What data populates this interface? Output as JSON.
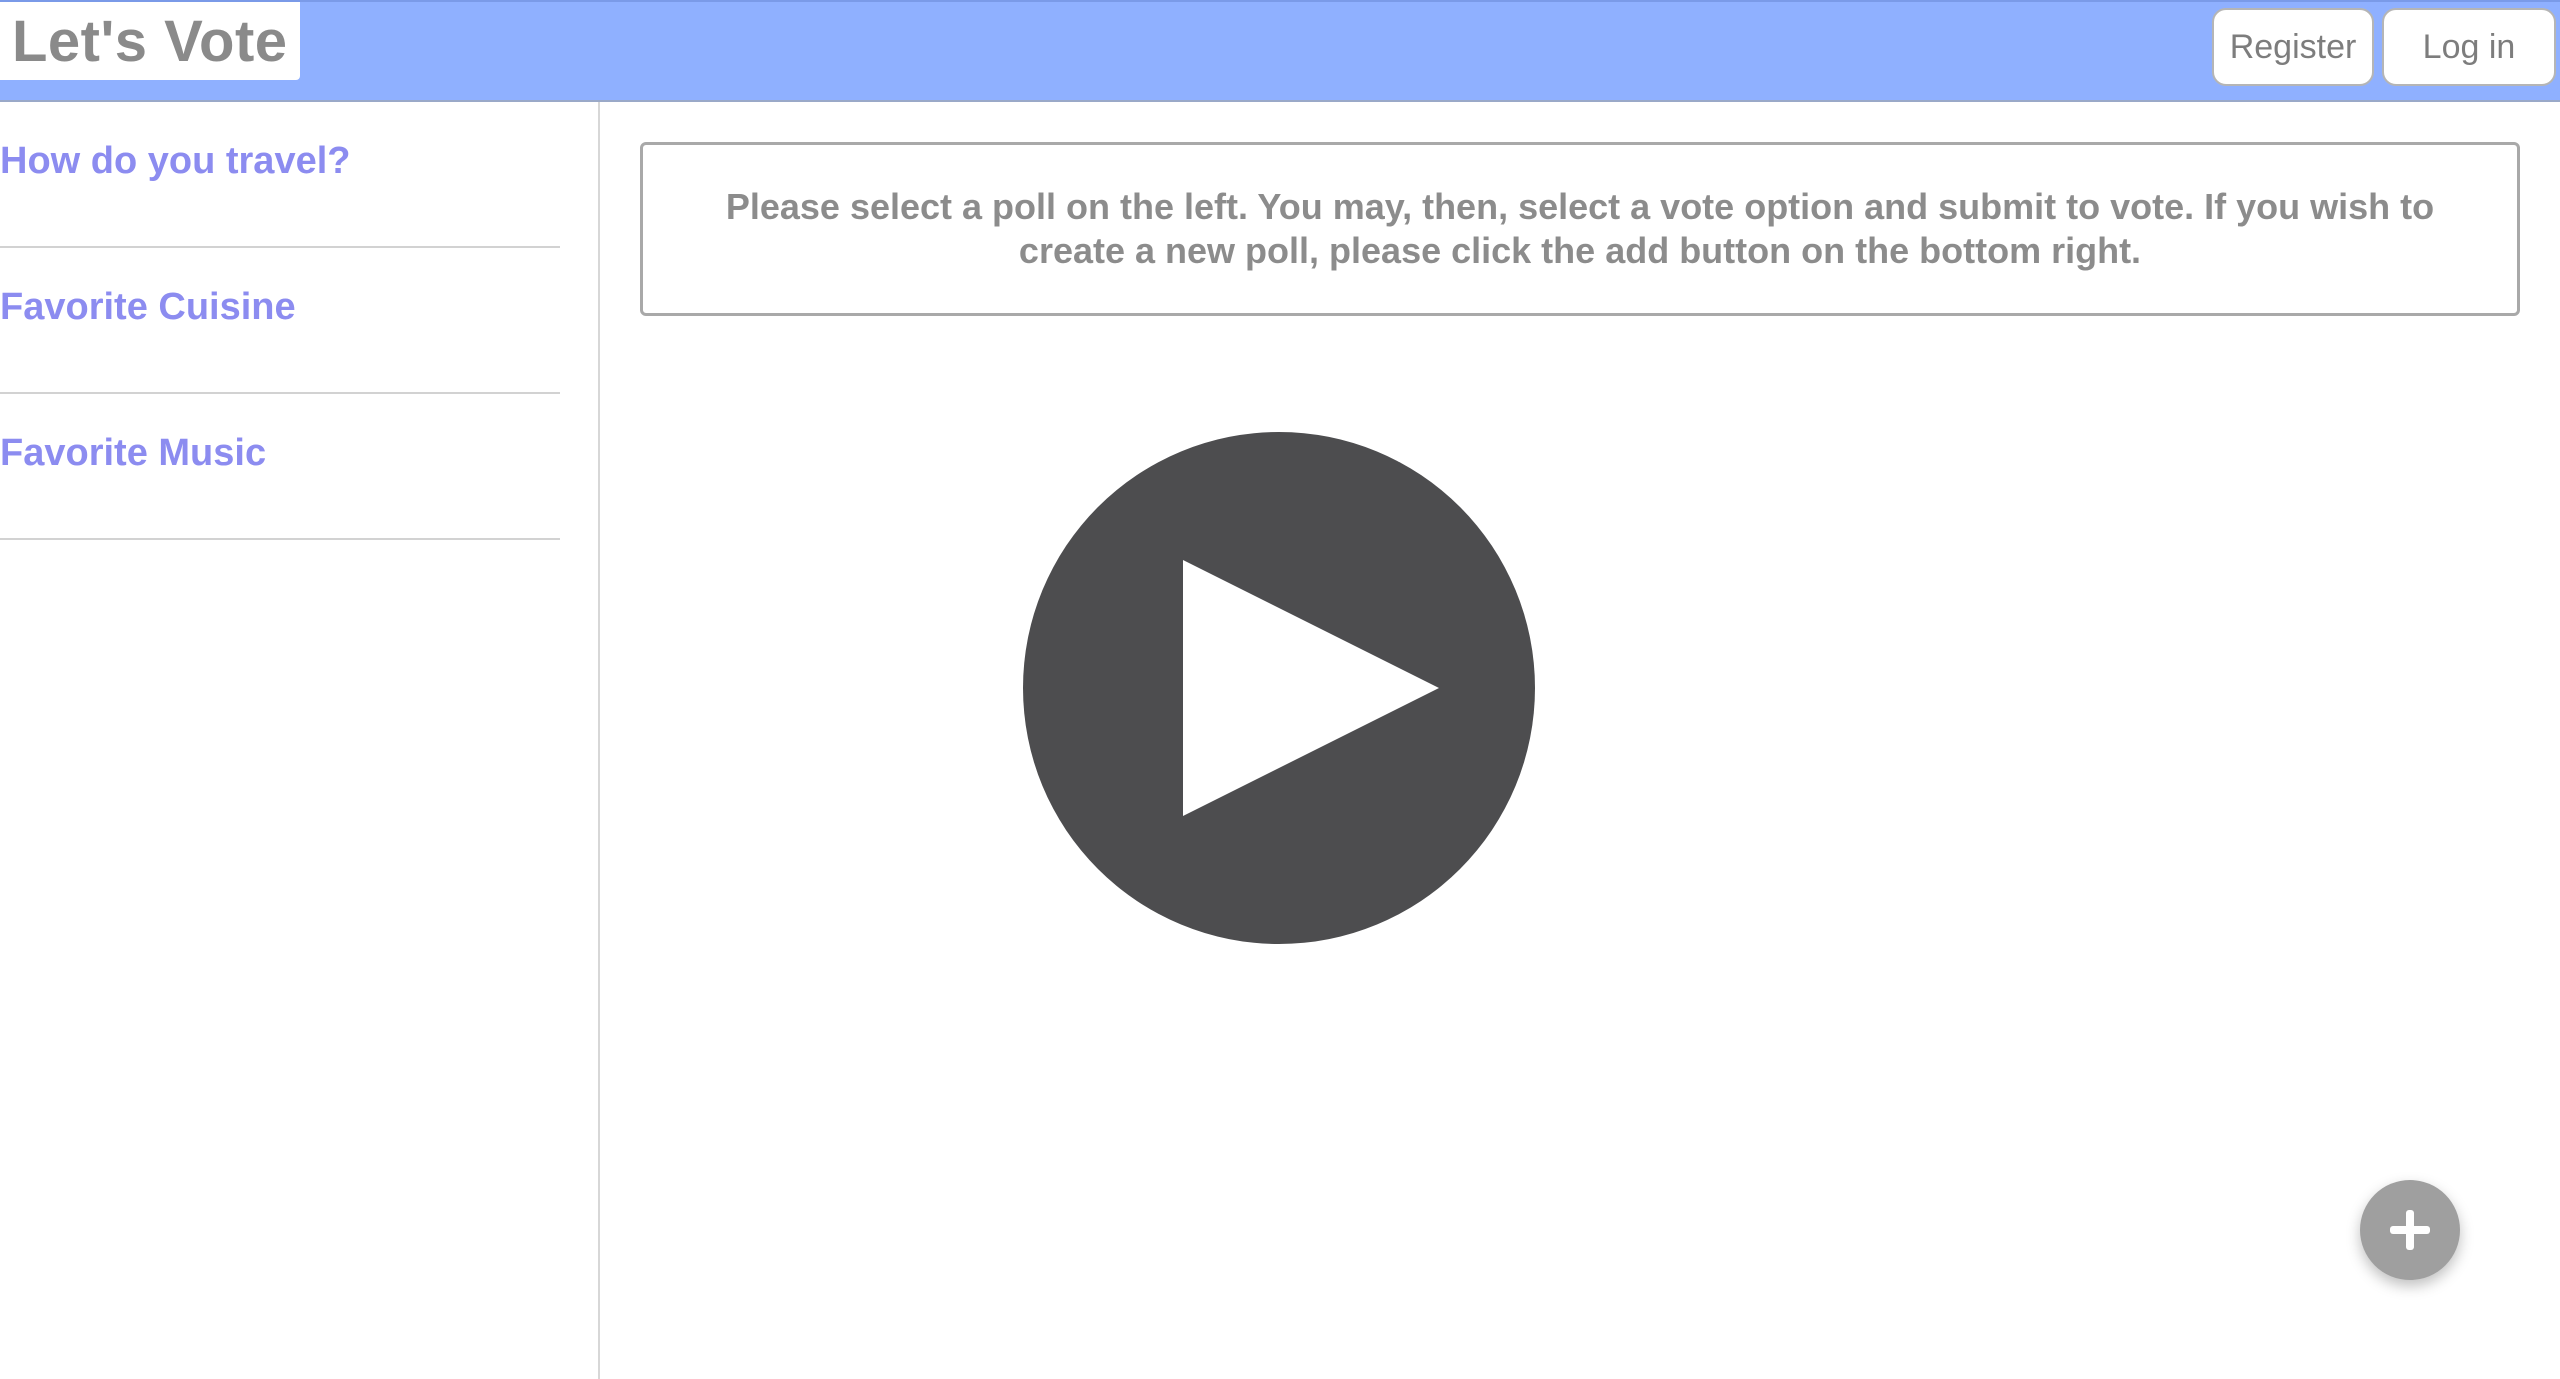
{
  "header": {
    "brand": "Let's Vote",
    "register_label": "Register",
    "login_label": "Log in"
  },
  "sidebar": {
    "polls": [
      {
        "label": "How do you travel?"
      },
      {
        "label": "Favorite Cuisine"
      },
      {
        "label": "Favorite Music"
      }
    ]
  },
  "main": {
    "instructions": "Please select a poll on the left. You may, then, select a vote option and submit to vote. If you wish to create a new poll, please click the add button on the bottom right.",
    "play_icon": "play-circle-icon",
    "add_icon": "plus-icon"
  },
  "colors": {
    "header_bg": "#8fb0ff",
    "poll_link": "#8c8cf0",
    "text_gray": "#8c8c8c",
    "play_circle": "#4d4d4f",
    "add_button": "#9f9f9f"
  }
}
